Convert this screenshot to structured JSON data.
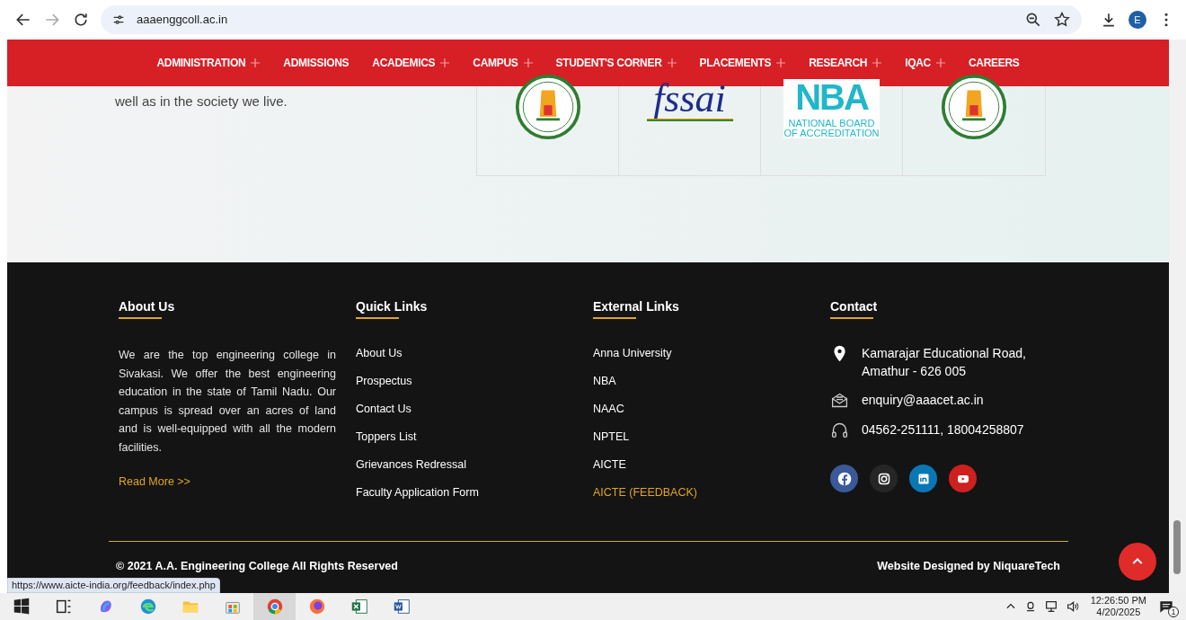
{
  "browser": {
    "url": "aaaenggcoll.ac.in",
    "profile_initial": "E"
  },
  "nav": [
    {
      "label": "ADMINISTRATION",
      "has_submenu": true
    },
    {
      "label": "ADMISSIONS",
      "has_submenu": false
    },
    {
      "label": "ACADEMICS",
      "has_submenu": true
    },
    {
      "label": "CAMPUS",
      "has_submenu": true
    },
    {
      "label": "STUDENT'S CORNER",
      "has_submenu": true
    },
    {
      "label": "PLACEMENTS",
      "has_submenu": true
    },
    {
      "label": "RESEARCH",
      "has_submenu": true
    },
    {
      "label": "IQAC",
      "has_submenu": true
    },
    {
      "label": "CAREERS",
      "has_submenu": false
    }
  ],
  "intro_text": "well as in the society we live.",
  "logos": [
    {
      "kind": "emblem"
    },
    {
      "kind": "fssai",
      "text": "fssai"
    },
    {
      "kind": "nba",
      "mark": "NBA",
      "text": "NATIONAL BOARD",
      "subtext": "OF ACCREDITATION"
    },
    {
      "kind": "emblem"
    }
  ],
  "footer": {
    "about": {
      "title": "About Us",
      "text": "We are the top engineering college in Sivakasi. We offer the best engineering education in the state of Tamil Nadu. Our campus is spread over an acres of land and is well-equipped with all the modern facilities.",
      "read_more": "Read More >>"
    },
    "quick_links": {
      "title": "Quick Links",
      "links": [
        {
          "label": "About Us",
          "highlighted": false
        },
        {
          "label": "Prospectus",
          "highlighted": false
        },
        {
          "label": "Contact Us",
          "highlighted": false
        },
        {
          "label": "Toppers List",
          "highlighted": false
        },
        {
          "label": "Grievances Redressal",
          "highlighted": false
        },
        {
          "label": "Faculty Application Form",
          "highlighted": false
        }
      ]
    },
    "external_links": {
      "title": "External Links",
      "links": [
        {
          "label": "Anna University",
          "highlighted": false
        },
        {
          "label": "NBA",
          "highlighted": false
        },
        {
          "label": "NAAC",
          "highlighted": false
        },
        {
          "label": "NPTEL",
          "highlighted": false
        },
        {
          "label": "AICTE",
          "highlighted": false
        },
        {
          "label": "AICTE (FEEDBACK)",
          "highlighted": true
        }
      ]
    },
    "contact": {
      "title": "Contact",
      "items": [
        {
          "kind": "address",
          "lines": [
            "Kamarajar Educational Road,",
            "Amathur - 626 005"
          ]
        },
        {
          "kind": "email",
          "lines": [
            "enquiry@aaacet.ac.in"
          ]
        },
        {
          "kind": "phone",
          "lines": [
            "04562-251111, 18004258807"
          ]
        }
      ],
      "social": [
        {
          "kind": "facebook",
          "color": "#3b5998"
        },
        {
          "kind": "instagram",
          "color": "#262626"
        },
        {
          "kind": "linkedin",
          "color": "#0a77b5"
        },
        {
          "kind": "youtube",
          "color": "#cd201f"
        }
      ]
    },
    "copyright": "© 2021 A.A. Engineering College All Rights Reserved",
    "credit": "Website Designed by NiquareTech"
  },
  "status_url": "https://www.aicte-india.org/feedback/index.php",
  "taskbar": {
    "time": "12:26:50 PM",
    "date": "4/20/2025",
    "notification_count": "1"
  }
}
